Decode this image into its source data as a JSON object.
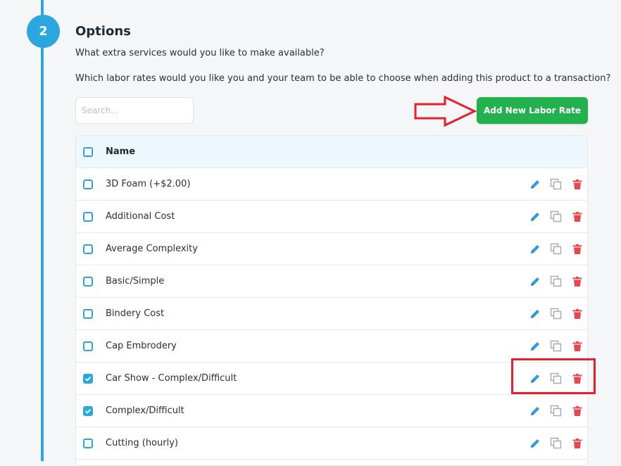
{
  "step": {
    "number": "2"
  },
  "section": {
    "title": "Options",
    "subtitle": "What extra services would you like to make available?",
    "question": "Which labor rates would you like you and your team to be able to choose when adding this product to a transaction?"
  },
  "search": {
    "placeholder": "Search...",
    "value": ""
  },
  "add_button": {
    "label": "Add New Labor Rate"
  },
  "table": {
    "header": {
      "name": "Name",
      "checked": false
    },
    "rows": [
      {
        "name": "3D Foam (+$2.00)",
        "checked": false
      },
      {
        "name": "Additional Cost",
        "checked": false
      },
      {
        "name": "Average Complexity",
        "checked": false
      },
      {
        "name": "Basic/Simple",
        "checked": false
      },
      {
        "name": "Bindery Cost",
        "checked": false
      },
      {
        "name": "Cap Embrodery",
        "checked": false
      },
      {
        "name": "Car Show - Complex/Difficult",
        "checked": true
      },
      {
        "name": "Complex/Difficult",
        "checked": true
      },
      {
        "name": "Cutting (hourly)",
        "checked": false
      }
    ],
    "row_icons": [
      "pencil-icon",
      "copy-icon",
      "trash-icon"
    ]
  },
  "colors": {
    "accent": "#2aa7df",
    "button_green": "#23b14d",
    "edit_blue": "#2a9ed8",
    "copy_gray": "#a7adb3",
    "delete_red": "#e8474c",
    "annotation_red": "#e8202a"
  }
}
